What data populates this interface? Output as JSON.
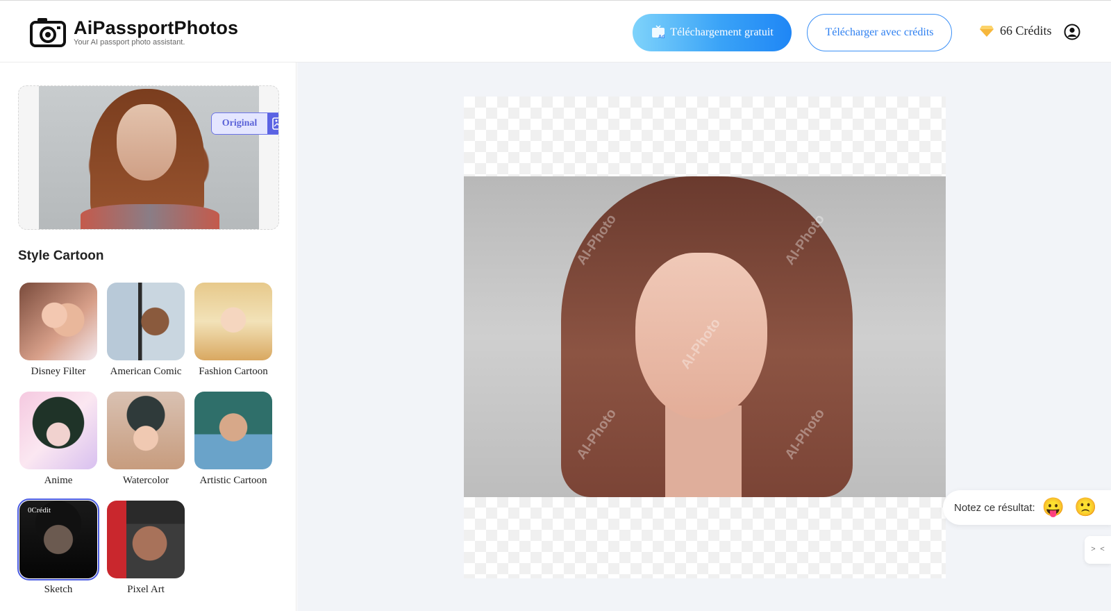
{
  "header": {
    "brand": "AiPassportPhotos",
    "tagline": "Your AI passport photo assistant.",
    "free_download_label": "Téléchargement gratuit",
    "credit_download_label": "Télécharger avec crédits",
    "credits_label": "66 Crédits"
  },
  "sidebar": {
    "original_label": "Original",
    "section_title": "Style Cartoon",
    "styles": [
      {
        "name": "Disney Filter"
      },
      {
        "name": "American Comic"
      },
      {
        "name": "Fashion Cartoon"
      },
      {
        "name": "Anime"
      },
      {
        "name": "Watercolor"
      },
      {
        "name": "Artistic Cartoon"
      },
      {
        "name": "Sketch",
        "badge": "0Crédit",
        "selected": true
      },
      {
        "name": "Pixel Art"
      }
    ]
  },
  "main": {
    "watermark": "AI-Photo"
  },
  "rating": {
    "label": "Notez ce résultat:",
    "like_icon": "😛",
    "dislike_icon": "🙁"
  },
  "side_button": {
    "label": "> <"
  },
  "colors": {
    "accent": "#3a8ff6",
    "brand_purple": "#5b63e3",
    "canvas_bg": "#f2f4f8"
  }
}
